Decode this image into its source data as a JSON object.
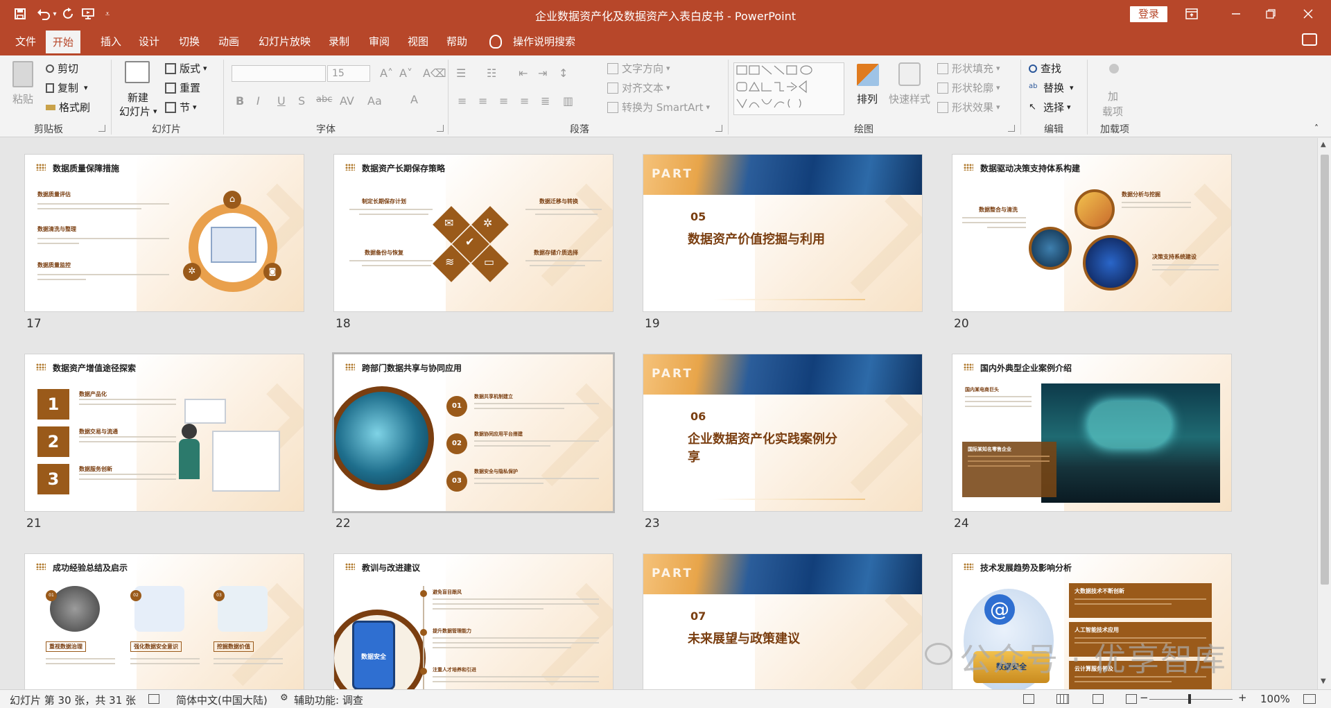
{
  "window": {
    "title": "企业数据资产化及数据资产入表白皮书 - PowerPoint",
    "login_label": "登录"
  },
  "quick_access": [
    "save-icon",
    "undo-icon",
    "redo-icon",
    "slideshow-from-start-icon",
    "customize-icon"
  ],
  "tabs": [
    {
      "label": "文件",
      "active": false
    },
    {
      "label": "开始",
      "active": true
    },
    {
      "label": "插入",
      "active": false
    },
    {
      "label": "设计",
      "active": false
    },
    {
      "label": "切换",
      "active": false
    },
    {
      "label": "动画",
      "active": false
    },
    {
      "label": "幻灯片放映",
      "active": false
    },
    {
      "label": "录制",
      "active": false
    },
    {
      "label": "审阅",
      "active": false
    },
    {
      "label": "视图",
      "active": false
    },
    {
      "label": "帮助",
      "active": false
    }
  ],
  "tell_me": "操作说明搜索",
  "ribbon": {
    "clipboard": {
      "label": "剪贴板",
      "paste": "粘贴",
      "cut": "剪切",
      "copy": "复制",
      "format_painter": "格式刷"
    },
    "slides": {
      "label": "幻灯片",
      "new_slide_1": "新建",
      "new_slide_2": "幻灯片",
      "layout": "版式",
      "reset": "重置",
      "section": "节"
    },
    "font": {
      "label": "字体",
      "font_name": "",
      "font_size": "15"
    },
    "paragraph": {
      "label": "段落",
      "text_direction": "文字方向",
      "align_text": "对齐文本",
      "smartart": "转换为 SmartArt"
    },
    "drawing": {
      "label": "绘图",
      "arrange": "排列",
      "quick_styles": "快速样式",
      "shape_fill": "形状填充",
      "shape_outline": "形状轮廓",
      "shape_effects": "形状效果"
    },
    "editing": {
      "label": "编辑",
      "find": "查找",
      "replace": "替换",
      "select": "选择"
    },
    "addins": {
      "label": "加载项",
      "addins_1": "加",
      "addins_2": "载项"
    }
  },
  "slides": [
    {
      "num": "17",
      "title": "数据质量保障措施",
      "items": [
        "数据质量评估",
        "数据清洗与整理",
        "数据质量监控"
      ]
    },
    {
      "num": "18",
      "title": "数据资产长期保存策略",
      "items": [
        "制定长期保存计划",
        "数据迁移与转换",
        "数据备份与恢复",
        "数据存储介质选择"
      ]
    },
    {
      "num": "19",
      "part": "PART",
      "part_num": "05",
      "title": "数据资产价值挖掘与利用"
    },
    {
      "num": "20",
      "title": "数据驱动决策支持体系构建",
      "items": [
        "数据分析与挖掘",
        "数据整合与清洗",
        "决策支持系统建设"
      ]
    },
    {
      "num": "21",
      "title": "数据资产增值途径探索",
      "items": [
        "数据产品化",
        "数据交易与流通",
        "数据服务创新"
      ],
      "badges": [
        "1",
        "2",
        "3"
      ]
    },
    {
      "num": "22",
      "title": "跨部门数据共享与协同应用",
      "items": [
        "数据共享机制建立",
        "数据协同应用平台搭建",
        "数据安全与隐私保护"
      ],
      "badges": [
        "01",
        "02",
        "03"
      ]
    },
    {
      "num": "23",
      "part": "PART",
      "part_num": "06",
      "title": "企业数据资产化实践案例分享"
    },
    {
      "num": "24",
      "title": "国内外典型企业案例介绍",
      "items": [
        "国内某电商巨头",
        "国际某知名零售企业"
      ]
    },
    {
      "num": "",
      "title": "成功经验总结及启示",
      "items": [
        "重视数据治理",
        "强化数据安全意识",
        "挖掘数据价值"
      ],
      "badges": [
        "01",
        "02",
        "03"
      ]
    },
    {
      "num": "",
      "title": "教训与改进建议",
      "items": [
        "避免盲目跟风",
        "提升数据管理能力",
        "注重人才培养和引进"
      ],
      "phone_text": "数据安全"
    },
    {
      "num": "",
      "part": "PART",
      "part_num": "07",
      "title": "未来展望与政策建议"
    },
    {
      "num": "",
      "title": "技术发展趋势及影响分析",
      "items": [
        "大数据技术不断创新",
        "人工智能技术应用",
        "云计算服务普及"
      ],
      "image_text": "数据安全"
    }
  ],
  "status": {
    "slide_info": "幻灯片 第 30 张，共 31 张",
    "language": "简体中文(中国大陆)",
    "accessibility": "辅助功能: 调查",
    "zoom": "100%"
  },
  "watermark": "公众号 · 优享智库",
  "colors": {
    "accent": "#b7472a",
    "brown": "#9a5a1a",
    "ribbon_bg": "#f3f3f3",
    "part_blue": "#123f7a"
  }
}
